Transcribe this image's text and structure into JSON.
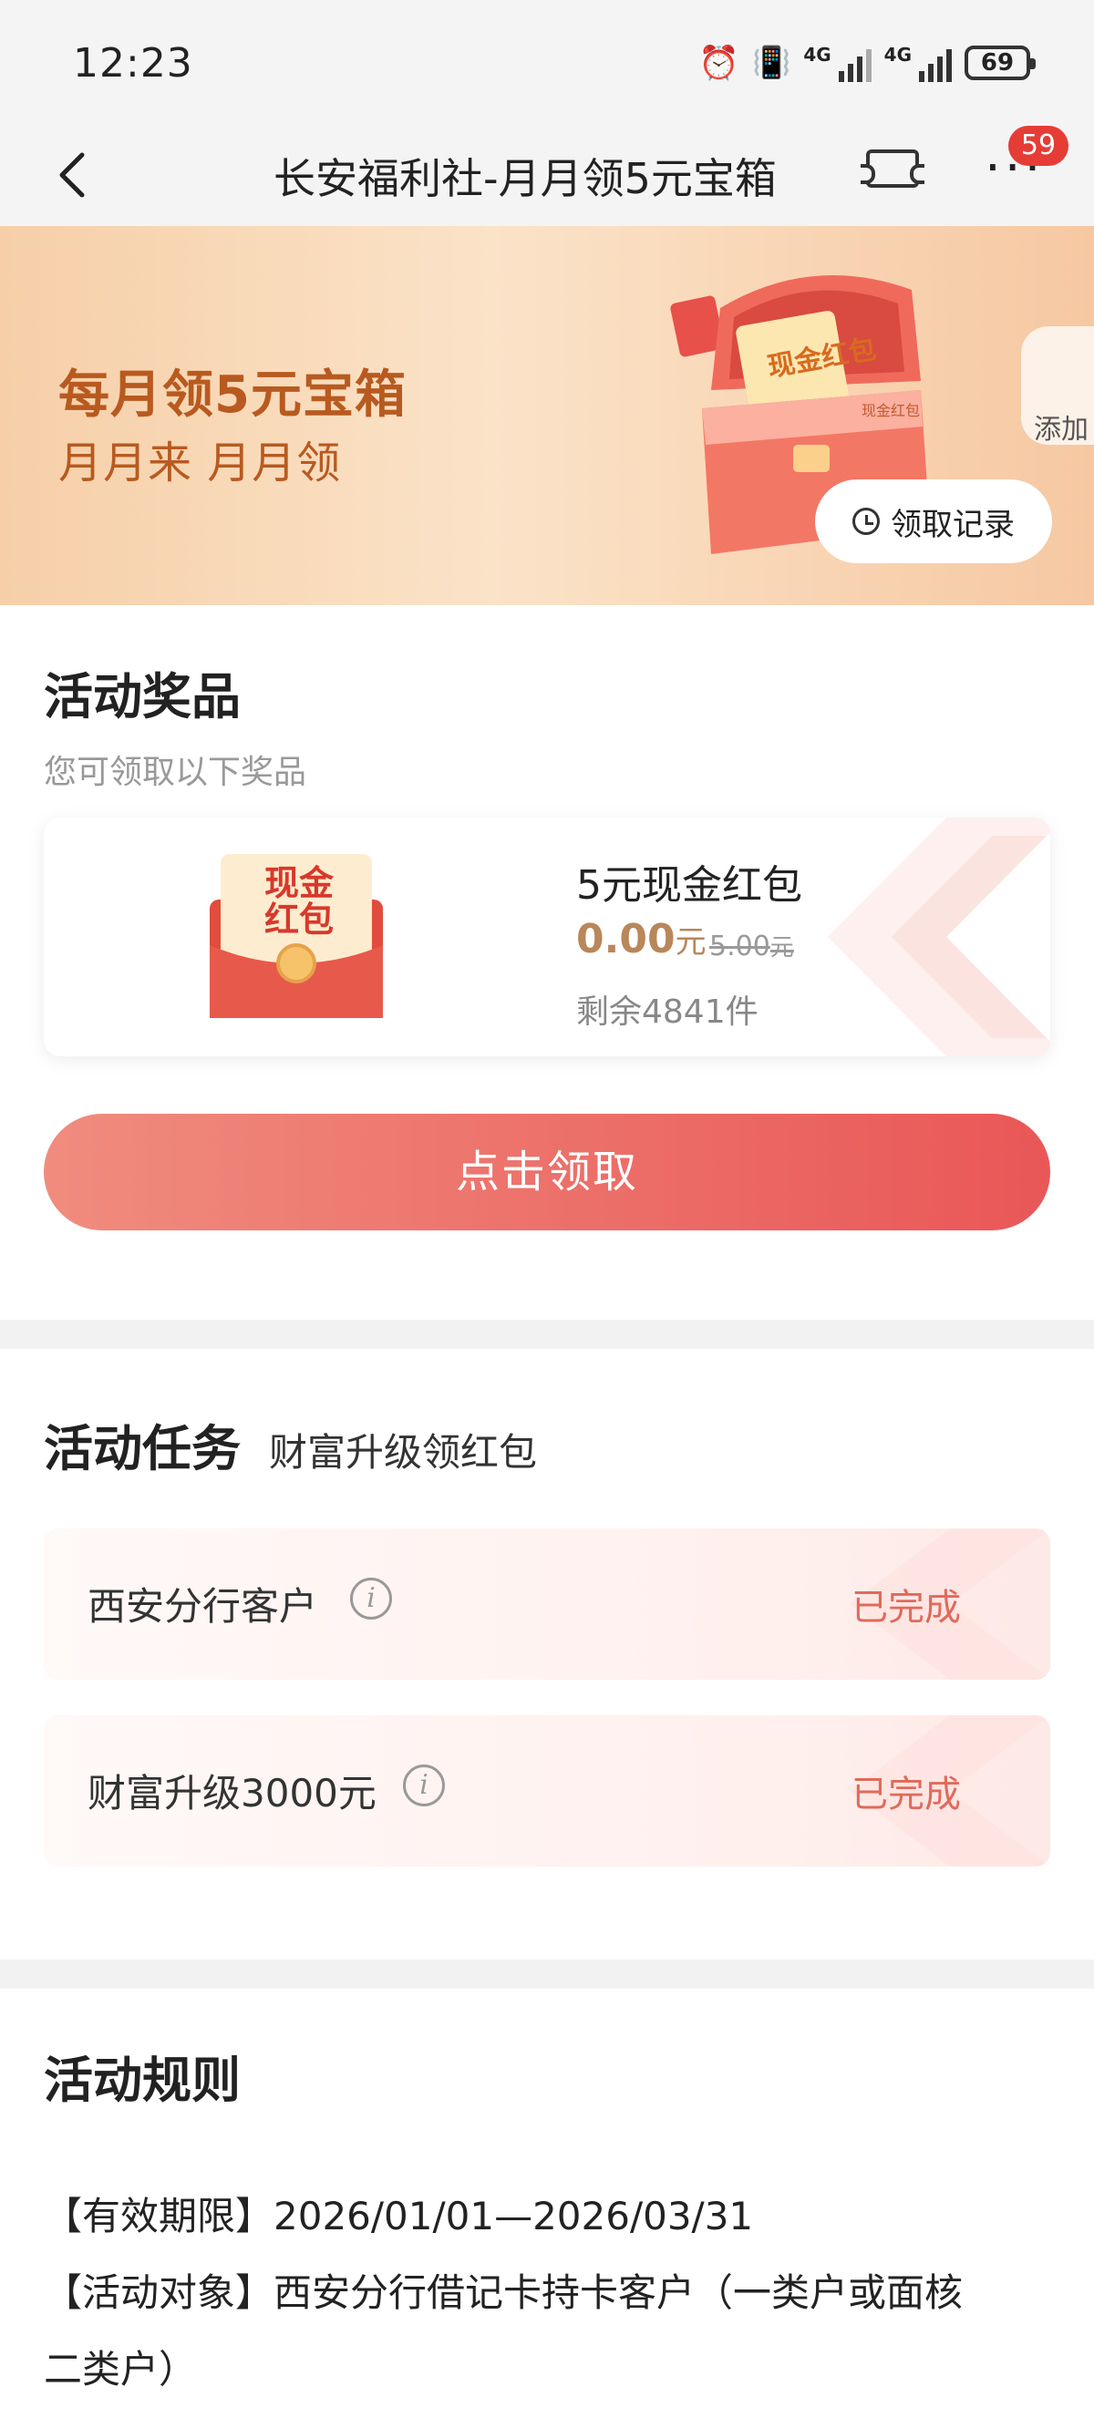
{
  "status_bar": {
    "time": "12:23",
    "network1": "4G",
    "network2": "4G",
    "battery": "69"
  },
  "nav": {
    "title": "长安福利社-月月领5元宝箱",
    "badge": "59"
  },
  "banner": {
    "title": "每月领5元宝箱",
    "subtitle": "月月来 月月领",
    "records_button": "领取记录",
    "add_label": "添加",
    "chest_label": "现金红包",
    "ticket_label": "现金红包"
  },
  "prizes": {
    "heading": "活动奖品",
    "subheading": "您可领取以下奖品",
    "item": {
      "envelope_text": "现金\n红包",
      "name": "5元现金红包",
      "price": "0.00",
      "price_unit": "元",
      "original_price": "5.00",
      "original_unit": "元",
      "remaining": "剩余4841件"
    },
    "claim_button": "点击领取"
  },
  "tasks": {
    "heading": "活动任务",
    "subheading": "财富升级领红包",
    "items": [
      {
        "name": "西安分行客户",
        "status": "已完成"
      },
      {
        "name": "财富升级3000元",
        "status": "已完成"
      }
    ]
  },
  "rules": {
    "heading": "活动规则",
    "lines": [
      "【有效期限】2026/01/01—2026/03/31",
      "【活动对象】西安分行借记卡持卡客户（一类户或面核",
      "二类户）"
    ]
  },
  "colors": {
    "accent": "#e95757",
    "banner_text": "#b85a20",
    "price": "#b8875a",
    "done": "#e06a5a",
    "badge": "#e53c36"
  }
}
